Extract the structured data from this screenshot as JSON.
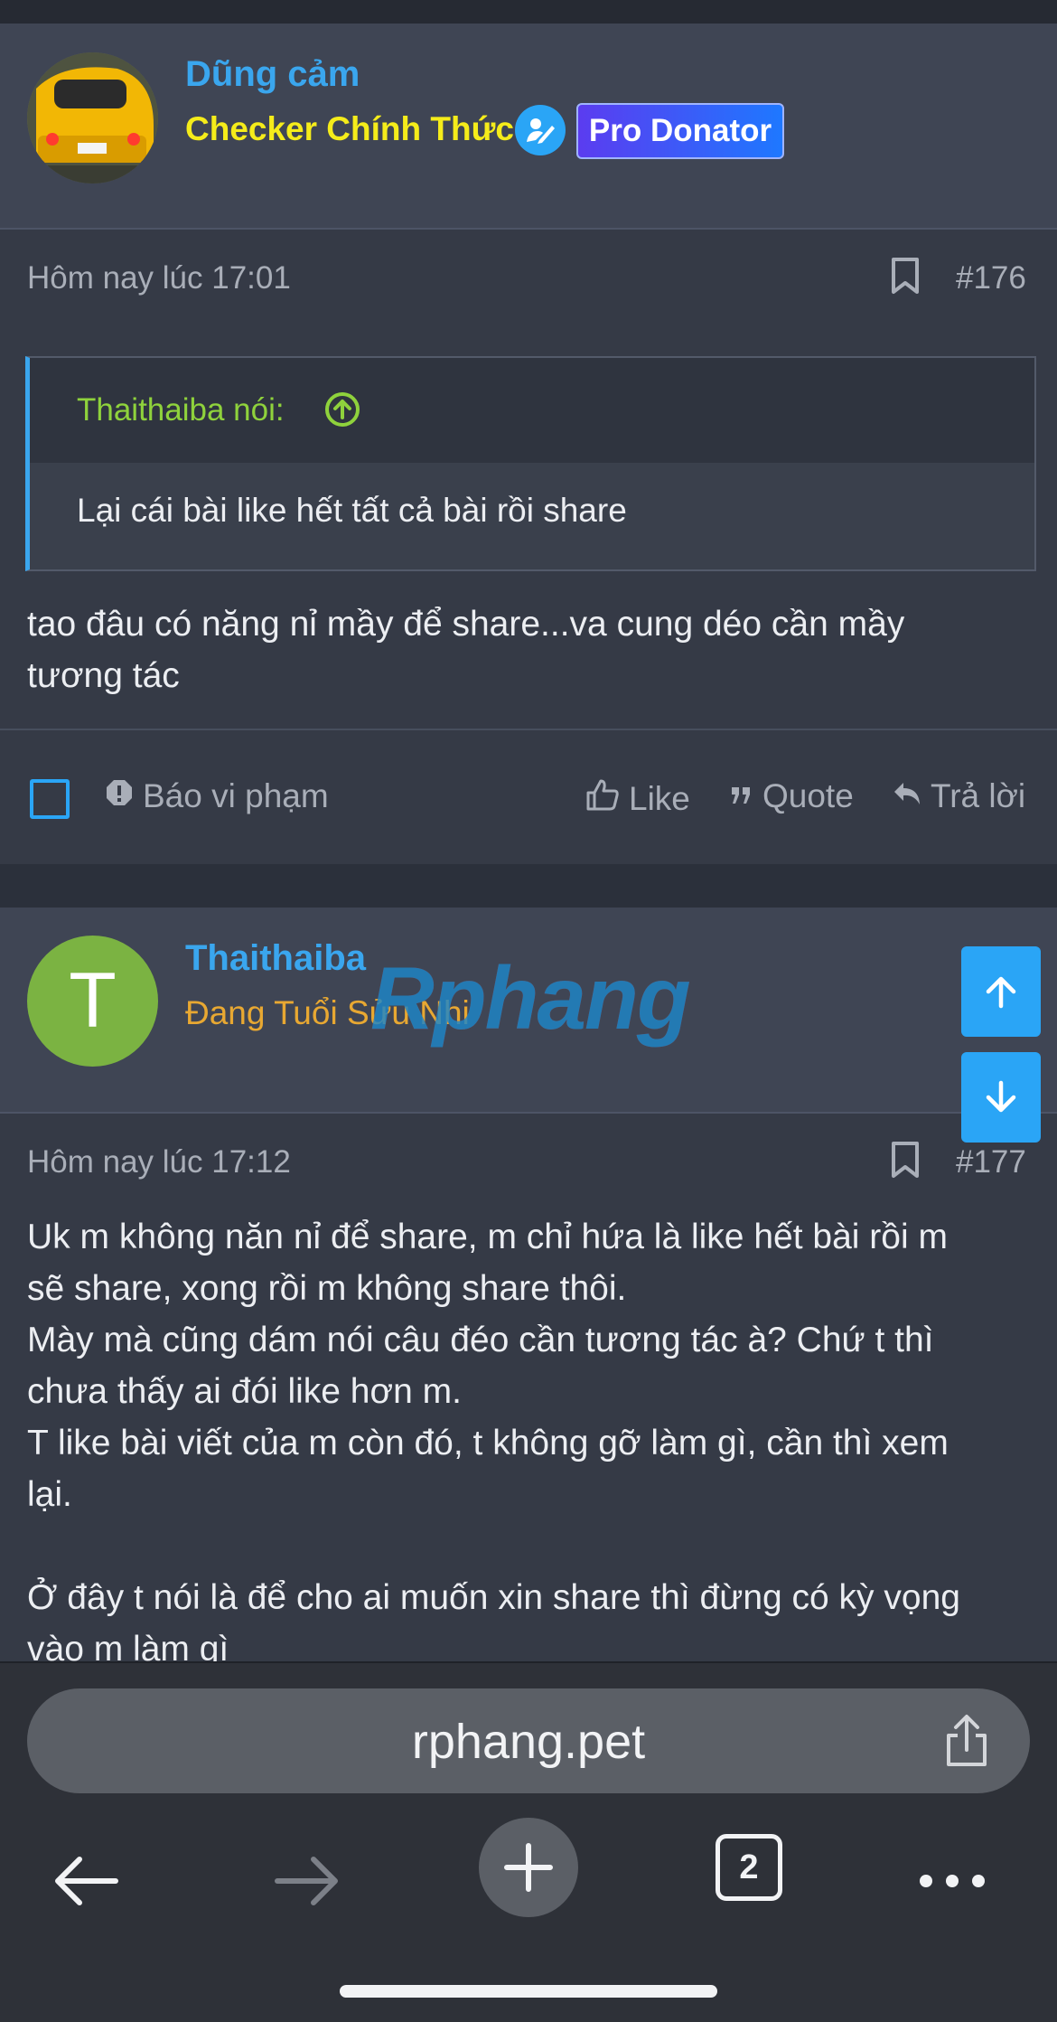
{
  "post1": {
    "author": "Dũng cảm",
    "title": "Checker Chính Thức",
    "badge": "Pro Donator",
    "time": "Hôm nay lúc 17:01",
    "number": "#176",
    "quote_author": "Thaithaiba nói:",
    "quote_text": "Lại cái bài like hết tất cả bài rồi share",
    "body": "tao đâu có năng nỉ mầy để share...va cung déo cần mầy\ntương tác",
    "actions": {
      "report": "Báo vi phạm",
      "like": "Like",
      "quote": "Quote",
      "reply": "Trả lời"
    }
  },
  "post2": {
    "avatar_letter": "T",
    "author": "Thaithaiba",
    "title": "Đang Tuổi Sửu Nhi",
    "time": "Hôm nay lúc 17:12",
    "number": "#177",
    "body": "Uk m không năn nỉ để share, m chỉ hứa là like hết bài rồi m\nsẽ share, xong rồi m không share thôi.\nMày mà cũng dám nói câu đéo cần tương tác à? Chứ t thì\nchưa thấy ai đói like hơn m.\nT like bài viết của m còn đó, t không gỡ làm gì, cần thì xem\nlại.\n\nỞ đây t nói là để cho ai muốn xin share thì đừng có kỳ vọng\nvào m làm gì"
  },
  "watermark": "Rphang",
  "browser": {
    "url": "rphang.pet",
    "tab_count": "2"
  },
  "colors": {
    "accent": "#3aa6ee",
    "checker_title": "#f5ec1a",
    "user2_title": "#e8a832",
    "quote_author": "#8fd23c",
    "fab": "#2aa5f6",
    "avatar2": "#7bb342"
  }
}
